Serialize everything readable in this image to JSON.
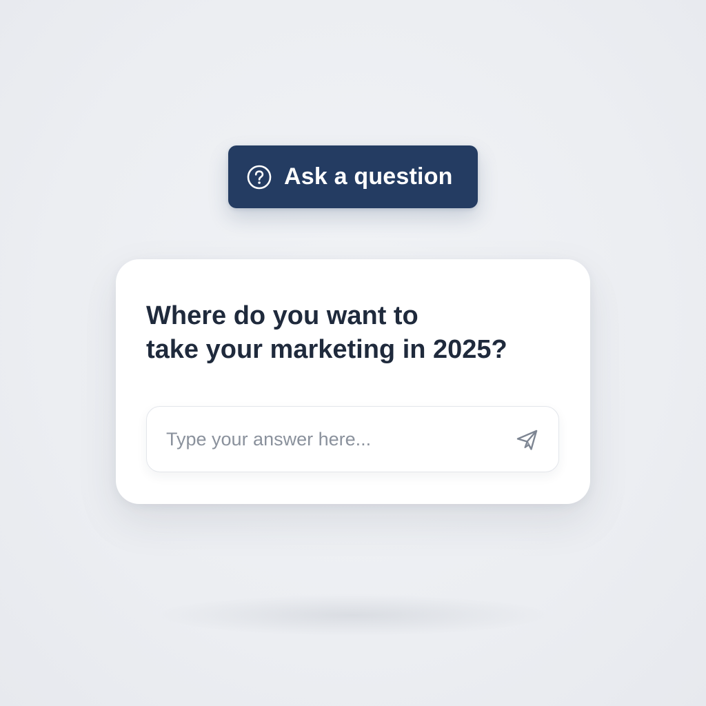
{
  "ask_button": {
    "label": "Ask a question",
    "icon": "question-circle-icon",
    "background": "#243c62"
  },
  "card": {
    "question_line_1": "Where do you want to",
    "question_line_2": "take your marketing in 2025?",
    "answer": {
      "value": "",
      "placeholder": "Type your answer here...",
      "send_icon": "send-paper-plane-icon"
    }
  },
  "colors": {
    "page_background": "#eceef2",
    "card_background": "#ffffff",
    "question_text": "#1f2a3c",
    "placeholder_text": "#8a919c",
    "icon_gray": "#7d8592"
  }
}
